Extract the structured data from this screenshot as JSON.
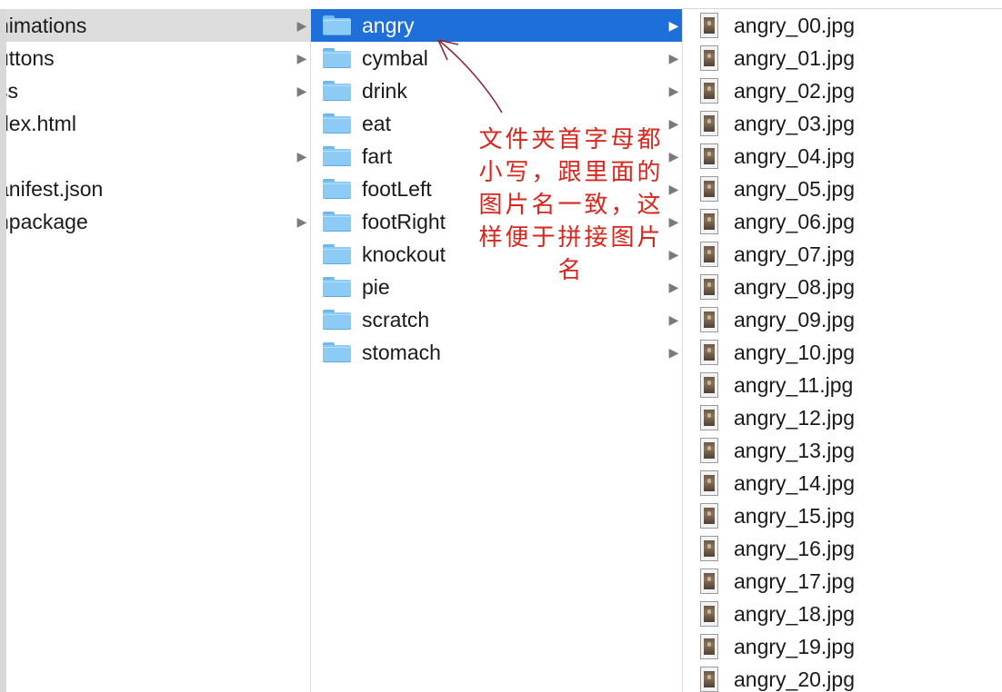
{
  "column1": {
    "items": [
      {
        "label": "nimations",
        "has_children": true,
        "selected": true
      },
      {
        "label": "uttons",
        "has_children": true
      },
      {
        "label": "ss",
        "has_children": true
      },
      {
        "label": "dex.html",
        "has_children": false
      },
      {
        "label": "",
        "has_children": true
      },
      {
        "label": "anifest.json",
        "has_children": false
      },
      {
        "label": "npackage",
        "has_children": true
      }
    ]
  },
  "column2": {
    "items": [
      {
        "label": "angry",
        "icon": "folder-icon",
        "has_children": true,
        "selected": true
      },
      {
        "label": "cymbal",
        "icon": "folder-icon",
        "has_children": true
      },
      {
        "label": "drink",
        "icon": "folder-icon",
        "has_children": true
      },
      {
        "label": "eat",
        "icon": "folder-icon",
        "has_children": true
      },
      {
        "label": "fart",
        "icon": "folder-icon",
        "has_children": true
      },
      {
        "label": "footLeft",
        "icon": "folder-icon",
        "has_children": true
      },
      {
        "label": "footRight",
        "icon": "folder-icon",
        "has_children": true
      },
      {
        "label": "knockout",
        "icon": "folder-icon",
        "has_children": true
      },
      {
        "label": "pie",
        "icon": "folder-icon",
        "has_children": true
      },
      {
        "label": "scratch",
        "icon": "folder-icon",
        "has_children": true
      },
      {
        "label": "stomach",
        "icon": "folder-icon",
        "has_children": true
      }
    ]
  },
  "column3": {
    "items": [
      {
        "label": "angry_00.jpg",
        "icon": "image-file-icon"
      },
      {
        "label": "angry_01.jpg",
        "icon": "image-file-icon"
      },
      {
        "label": "angry_02.jpg",
        "icon": "image-file-icon"
      },
      {
        "label": "angry_03.jpg",
        "icon": "image-file-icon"
      },
      {
        "label": "angry_04.jpg",
        "icon": "image-file-icon"
      },
      {
        "label": "angry_05.jpg",
        "icon": "image-file-icon"
      },
      {
        "label": "angry_06.jpg",
        "icon": "image-file-icon"
      },
      {
        "label": "angry_07.jpg",
        "icon": "image-file-icon"
      },
      {
        "label": "angry_08.jpg",
        "icon": "image-file-icon"
      },
      {
        "label": "angry_09.jpg",
        "icon": "image-file-icon"
      },
      {
        "label": "angry_10.jpg",
        "icon": "image-file-icon"
      },
      {
        "label": "angry_11.jpg",
        "icon": "image-file-icon"
      },
      {
        "label": "angry_12.jpg",
        "icon": "image-file-icon"
      },
      {
        "label": "angry_13.jpg",
        "icon": "image-file-icon"
      },
      {
        "label": "angry_14.jpg",
        "icon": "image-file-icon"
      },
      {
        "label": "angry_15.jpg",
        "icon": "image-file-icon"
      },
      {
        "label": "angry_16.jpg",
        "icon": "image-file-icon"
      },
      {
        "label": "angry_17.jpg",
        "icon": "image-file-icon"
      },
      {
        "label": "angry_18.jpg",
        "icon": "image-file-icon"
      },
      {
        "label": "angry_19.jpg",
        "icon": "image-file-icon"
      },
      {
        "label": "angry_20.jpg",
        "icon": "image-file-icon"
      }
    ]
  },
  "annotation": {
    "lines": [
      "文件夹首字母都",
      "小写，跟里面的",
      "图片名一致，这",
      "样便于拼接图片",
      "名"
    ],
    "color": "#d9261c"
  },
  "colors": {
    "selected_active": "#1e6fd9",
    "selected_inactive": "#dcdcdc",
    "folder": "#8ccbf6"
  }
}
